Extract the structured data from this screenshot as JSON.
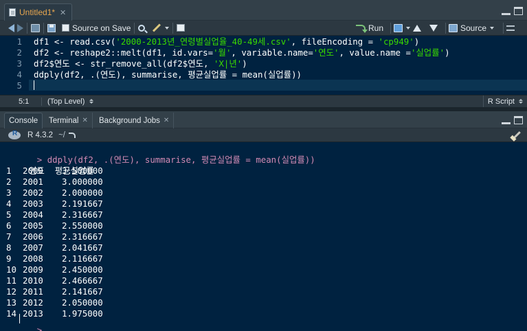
{
  "editor": {
    "tab_label": "Untitled1*",
    "toolbar": {
      "source_on_save": "Source on Save",
      "run": "Run",
      "source": "Source"
    },
    "code_lines": [
      {
        "num": "1",
        "parts": [
          {
            "t": "df1 <- read.csv(",
            "c": "kw"
          },
          {
            "t": "'2000-2013년_연령별실업율_40-49세.csv'",
            "c": "str"
          },
          {
            "t": ", fileEncoding = ",
            "c": "kw"
          },
          {
            "t": "'cp949'",
            "c": "str"
          },
          {
            "t": ")",
            "c": "kw"
          }
        ]
      },
      {
        "num": "2",
        "parts": [
          {
            "t": "df2 <- reshape2::melt(df1, id.vars=",
            "c": "kw"
          },
          {
            "t": "'월'",
            "c": "str"
          },
          {
            "t": ", variable.name=",
            "c": "kw"
          },
          {
            "t": "'연도'",
            "c": "str"
          },
          {
            "t": ", value.name =",
            "c": "kw"
          },
          {
            "t": "'실업률'",
            "c": "str"
          },
          {
            "t": ")",
            "c": "kw"
          }
        ]
      },
      {
        "num": "3",
        "parts": [
          {
            "t": "df2$연도 <- str_remove_all(df2$연도, ",
            "c": "kw"
          },
          {
            "t": "'X|년'",
            "c": "str"
          },
          {
            "t": ")",
            "c": "kw"
          }
        ]
      },
      {
        "num": "4",
        "parts": [
          {
            "t": "ddply(df2, .(연도), summarise, 평균실업률 = mean(실업률))",
            "c": "kw"
          }
        ]
      },
      {
        "num": "5",
        "parts": []
      }
    ],
    "status": {
      "position": "5:1",
      "scope": "(Top Level)",
      "file_type": "R Script"
    }
  },
  "console": {
    "tabs": [
      {
        "label": "Console",
        "closable": false
      },
      {
        "label": "Terminal",
        "closable": true
      },
      {
        "label": "Background Jobs",
        "closable": true
      }
    ],
    "r_version": "R 4.3.2",
    "working_dir": "~/",
    "prompt": ">",
    "command": "ddply(df2, .(연도), summarise, 평균실업률 = mean(실업률))",
    "header": "연도  평균실업률",
    "rows": [
      {
        "i": "1",
        "year": "2000",
        "value": "3.500000"
      },
      {
        "i": "2",
        "year": "2001",
        "value": "3.000000"
      },
      {
        "i": "3",
        "year": "2002",
        "value": "2.000000"
      },
      {
        "i": "4",
        "year": "2003",
        "value": "2.191667"
      },
      {
        "i": "5",
        "year": "2004",
        "value": "2.316667"
      },
      {
        "i": "6",
        "year": "2005",
        "value": "2.550000"
      },
      {
        "i": "7",
        "year": "2006",
        "value": "2.316667"
      },
      {
        "i": "8",
        "year": "2007",
        "value": "2.041667"
      },
      {
        "i": "9",
        "year": "2008",
        "value": "2.116667"
      },
      {
        "i": "10",
        "year": "2009",
        "value": "2.450000"
      },
      {
        "i": "11",
        "year": "2010",
        "value": "2.466667"
      },
      {
        "i": "12",
        "year": "2011",
        "value": "2.141667"
      },
      {
        "i": "13",
        "year": "2012",
        "value": "2.050000"
      },
      {
        "i": "14",
        "year": "2013",
        "value": "1.975000"
      }
    ]
  },
  "colors": {
    "background": "#002240",
    "string": "#3ad900",
    "prompt": "#d18ab3",
    "tab_modified": "#e7a64f"
  }
}
